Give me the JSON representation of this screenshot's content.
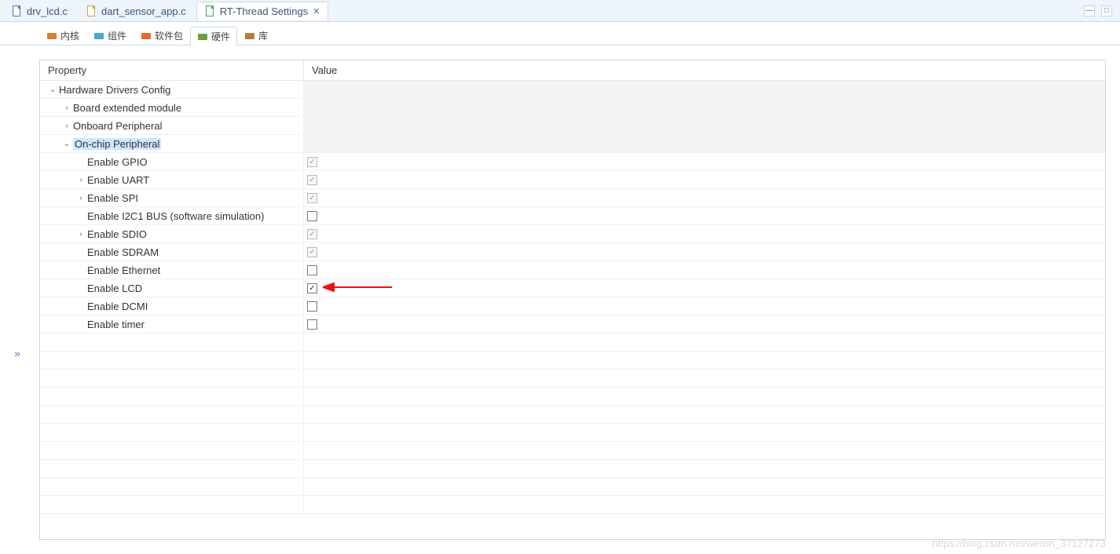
{
  "tabs": [
    {
      "label": "drv_lcd.c",
      "icon_color": "#3a7dc4"
    },
    {
      "label": "dart_sensor_app.c",
      "icon_color": "#d7a53a"
    },
    {
      "label": "RT-Thread Settings",
      "icon_color": "#4a9c5c",
      "active": true
    }
  ],
  "sub_tabs": [
    {
      "label": "内核",
      "icon_color": "#d67f2e"
    },
    {
      "label": "组件",
      "icon_color": "#4aa7d6"
    },
    {
      "label": "软件包",
      "icon_color": "#e46b2e"
    },
    {
      "label": "硬件",
      "icon_color": "#6a9f3d",
      "active": true
    },
    {
      "label": "库",
      "icon_color": "#b37f3d"
    }
  ],
  "columns": {
    "property": "Property",
    "value": "Value"
  },
  "tree": [
    {
      "indent": 0,
      "expander": "v",
      "label": "Hardware Drivers Config",
      "top_group": true
    },
    {
      "indent": 1,
      "expander": ">",
      "label": "Board extended module",
      "top_group": true
    },
    {
      "indent": 1,
      "expander": ">",
      "label": "Onboard Peripheral",
      "top_group": true
    },
    {
      "indent": 1,
      "expander": "v",
      "label": "On-chip Peripheral",
      "selected": true,
      "top_group": true
    },
    {
      "indent": 2,
      "label": "Enable GPIO",
      "check": true,
      "disabled": true
    },
    {
      "indent": 2,
      "expander": ">",
      "label": "Enable UART",
      "check": true,
      "disabled": true
    },
    {
      "indent": 2,
      "expander": ">",
      "label": "Enable SPI",
      "check": true,
      "disabled": true
    },
    {
      "indent": 2,
      "label": "Enable I2C1 BUS (software simulation)",
      "check": false
    },
    {
      "indent": 2,
      "expander": ">",
      "label": "Enable SDIO",
      "check": true,
      "disabled": true
    },
    {
      "indent": 2,
      "label": "Enable SDRAM",
      "check": true,
      "disabled": true
    },
    {
      "indent": 2,
      "label": "Enable Ethernet",
      "check": false
    },
    {
      "indent": 2,
      "label": "Enable LCD",
      "check": true,
      "arrow": true
    },
    {
      "indent": 2,
      "label": "Enable DCMI",
      "check": false
    },
    {
      "indent": 2,
      "label": "Enable timer",
      "check": false
    }
  ],
  "empty_rows": 10,
  "watermark": "https://blog.csdn.net/weixin_37127273"
}
